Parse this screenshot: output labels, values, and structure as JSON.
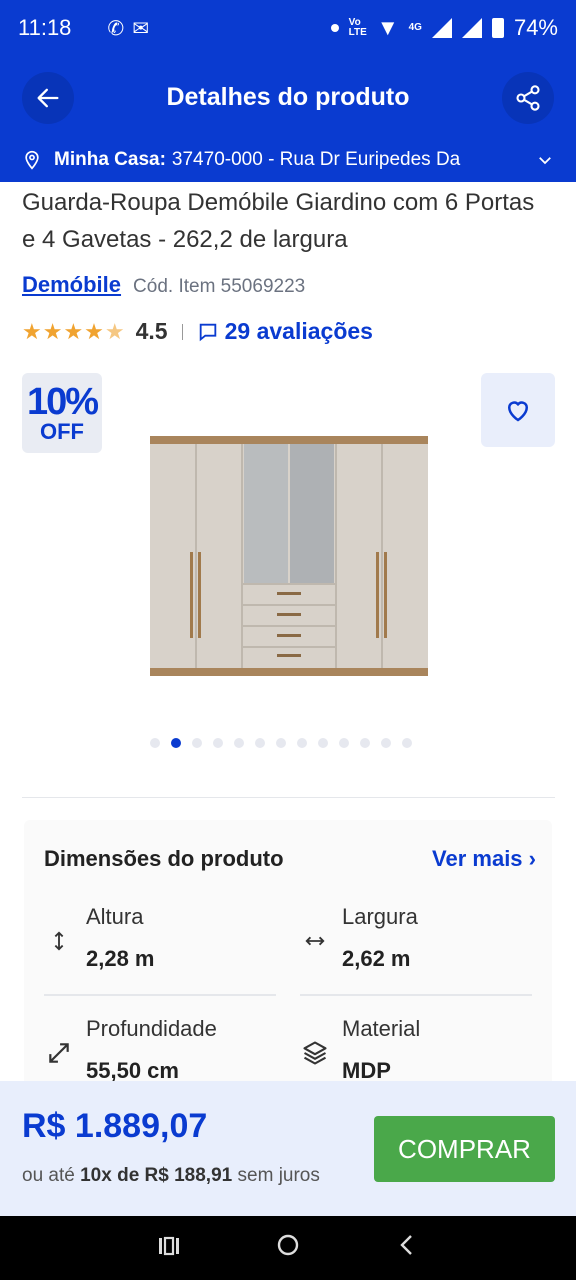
{
  "status_bar": {
    "time": "11:18",
    "battery": "74%",
    "network": "4G"
  },
  "header": {
    "title": "Detalhes do produto"
  },
  "address": {
    "label": "Minha Casa:",
    "value": "37470-000 - Rua Dr Euripedes Da"
  },
  "product": {
    "title": "Guarda-Roupa Demóbile Giardino com 6 Portas e 4 Gavetas - 262,2 de largura",
    "brand": "Demóbile",
    "code": "Cód. Item 55069223",
    "rating": "4.5",
    "reviews": "29 avaliações",
    "discount_pct": "10%",
    "discount_off": "OFF",
    "gallery_total": 13,
    "gallery_active": 2
  },
  "dimensions": {
    "title": "Dimensões do produto",
    "more": "Ver mais",
    "items": [
      {
        "label": "Altura",
        "value": "2,28 m",
        "icon": "vertical-arrows-icon"
      },
      {
        "label": "Largura",
        "value": "2,62 m",
        "icon": "horizontal-arrows-icon"
      },
      {
        "label": "Profundidade",
        "value": "55,50 cm",
        "icon": "diagonal-arrows-icon"
      },
      {
        "label": "Material",
        "value": "MDP",
        "icon": "layers-icon"
      }
    ]
  },
  "purchase": {
    "price": "R$ 1.889,07",
    "installment_prefix": "ou até",
    "installment_bold": "10x de R$ 188,91",
    "installment_suffix": "sem juros",
    "buy_label": "COMPRAR"
  },
  "colors": {
    "primary": "#0a3bd0",
    "buy": "#4aa84a",
    "star": "#f0a330"
  }
}
